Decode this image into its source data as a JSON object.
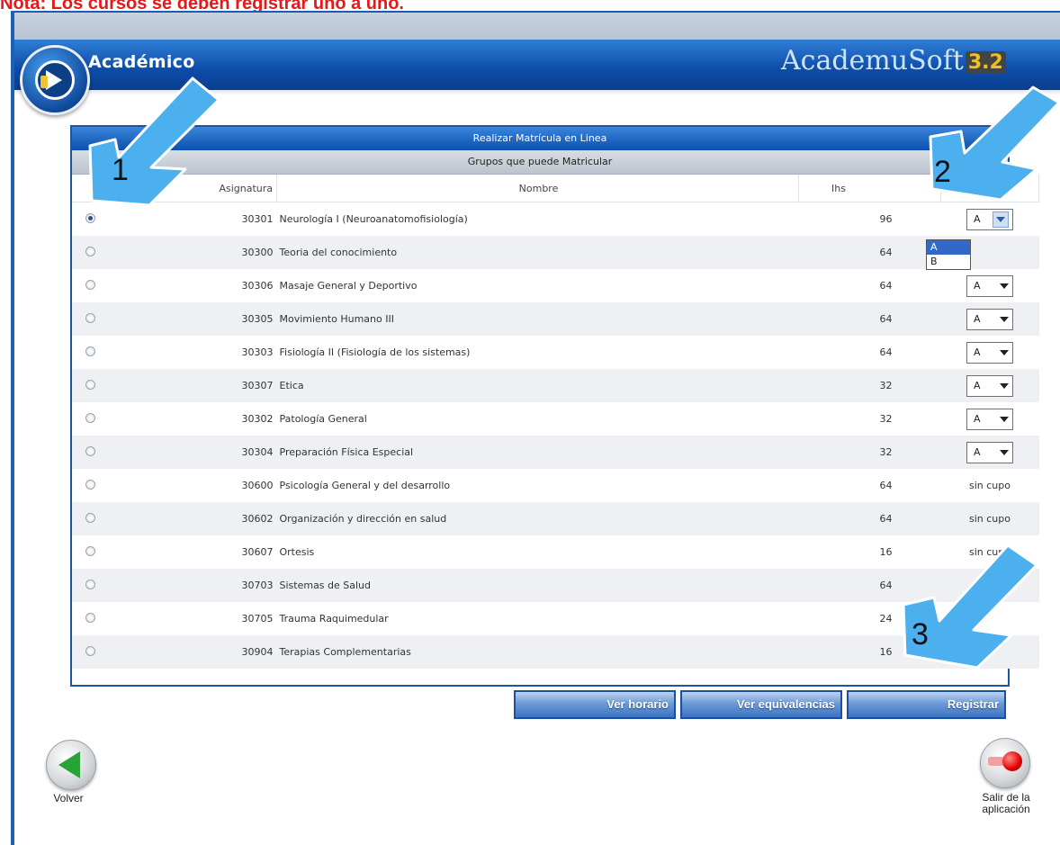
{
  "note": "Nota: Los cursos se deben registrar uno a uno.",
  "header": {
    "title": "Académico",
    "brand": "AcademuSoft",
    "brand_version": "3.2"
  },
  "panel": {
    "title": "Realizar Matrícula en Linea",
    "subtitle": "Grupos que puede Matricular",
    "columns": {
      "code": "Asignatura",
      "name": "Nombre",
      "ihs": "Ihs",
      "group": ""
    }
  },
  "rows": [
    {
      "code": "30301",
      "name": "Neurología I (Neuroanatomofisiología)",
      "ihs": "96",
      "group": "A",
      "selected": true,
      "open": true
    },
    {
      "code": "30300",
      "name": "Teoria del conocimiento",
      "ihs": "64",
      "group": ""
    },
    {
      "code": "30306",
      "name": "Masaje General y Deportivo",
      "ihs": "64",
      "group": "A"
    },
    {
      "code": "30305",
      "name": "Movimiento Humano III",
      "ihs": "64",
      "group": "A"
    },
    {
      "code": "30303",
      "name": "Fisiología II (Fisiología de los sistemas)",
      "ihs": "64",
      "group": "A"
    },
    {
      "code": "30307",
      "name": "Etica",
      "ihs": "32",
      "group": "A"
    },
    {
      "code": "30302",
      "name": "Patología General",
      "ihs": "32",
      "group": "A"
    },
    {
      "code": "30304",
      "name": "Preparación Física Especial",
      "ihs": "32",
      "group": "A"
    },
    {
      "code": "30600",
      "name": "Psicología General y del desarrollo",
      "ihs": "64",
      "group": "sin cupo"
    },
    {
      "code": "30602",
      "name": "Organización y dirección en salud",
      "ihs": "64",
      "group": "sin cupo"
    },
    {
      "code": "30607",
      "name": "Ortesis",
      "ihs": "16",
      "group": "sin cupo"
    },
    {
      "code": "30703",
      "name": "Sistemas de Salud",
      "ihs": "64",
      "group": ""
    },
    {
      "code": "30705",
      "name": "Trauma Raquimedular",
      "ihs": "24",
      "group": ""
    },
    {
      "code": "30904",
      "name": "Terapias Complementarias",
      "ihs": "16",
      "group": ""
    }
  ],
  "dropdown": {
    "options": [
      "A",
      "B"
    ],
    "active": "A"
  },
  "buttons": {
    "schedule": "Ver horario",
    "equivalences": "Ver equivalencias",
    "register": "Registrar"
  },
  "nav": {
    "back": "Volver",
    "exit_line1": "Salir de la",
    "exit_line2": "aplicación"
  },
  "annotations": [
    {
      "number": "1"
    },
    {
      "number": "2"
    },
    {
      "number": "3"
    }
  ],
  "colors": {
    "note_red": "#e31a1a",
    "header_blue": "#0c4ca8",
    "arrow_blue": "#4db0ee"
  }
}
